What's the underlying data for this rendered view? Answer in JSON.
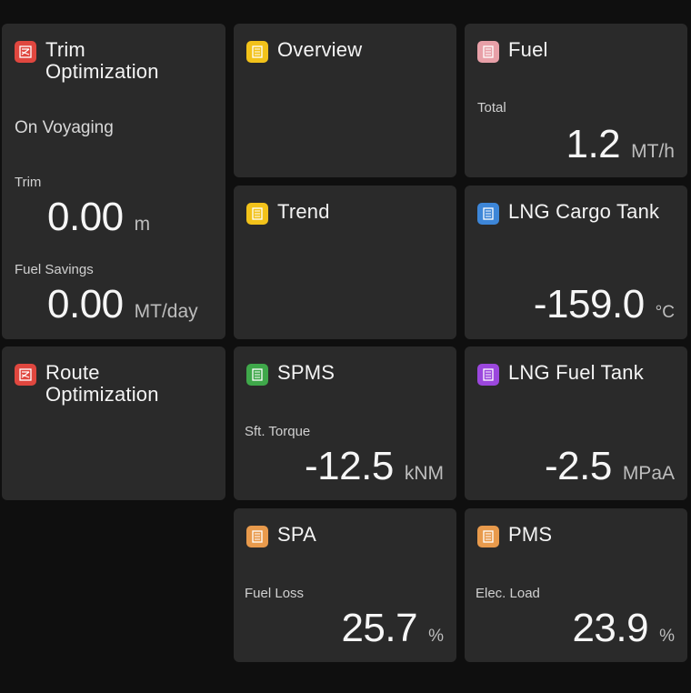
{
  "tiles": {
    "trim": {
      "title": "Trim Optimization",
      "status": "On Voyaging",
      "trim_label": "Trim",
      "trim_value": "0.00",
      "trim_unit": "m",
      "savings_label": "Fuel Savings",
      "savings_value": "0.00",
      "savings_unit": "MT/day",
      "icon": "route-grid-icon",
      "color": "#e0473f"
    },
    "route": {
      "title": "Route Optimization",
      "icon": "route-grid-icon",
      "color": "#e0473f"
    },
    "overview": {
      "title": "Overview",
      "icon": "panel-grid-icon",
      "color": "#f2c21a"
    },
    "trend": {
      "title": "Trend",
      "icon": "panel-grid-icon",
      "color": "#f2c21a"
    },
    "fuel": {
      "title": "Fuel",
      "label": "Total",
      "value": "1.2",
      "unit": "MT/h",
      "icon": "panel-grid-icon",
      "color": "#e8a0a8"
    },
    "lng_cargo": {
      "title": "LNG Cargo Tank",
      "value": "-159.0",
      "unit": "°C",
      "icon": "panel-grid-icon",
      "color": "#3d86d8"
    },
    "spms": {
      "title": "SPMS",
      "label": "Sft. Torque",
      "value": "-12.5",
      "unit": "kNM",
      "icon": "panel-grid-icon",
      "color": "#3fa84a"
    },
    "lng_fuel": {
      "title": "LNG Fuel Tank",
      "value": "-2.5",
      "unit": "MPaA",
      "icon": "panel-grid-icon",
      "color": "#9b47dd"
    },
    "spa": {
      "title": "SPA",
      "label": "Fuel Loss",
      "value": "25.7",
      "unit": "%",
      "icon": "panel-grid-icon",
      "color": "#e89a4c"
    },
    "pms": {
      "title": "PMS",
      "label": "Elec. Load",
      "value": "23.9",
      "unit": "%",
      "icon": "panel-grid-icon",
      "color": "#e89a4c"
    }
  }
}
